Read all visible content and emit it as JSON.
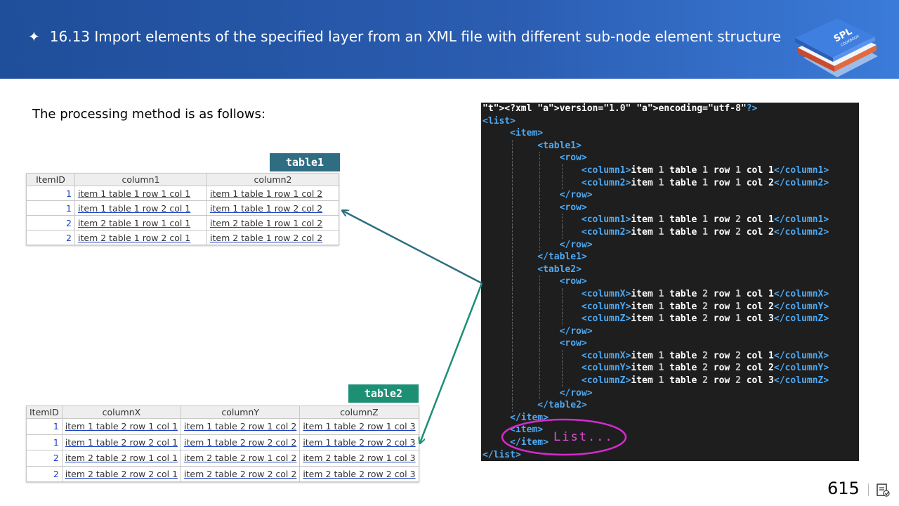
{
  "header": {
    "title": "16.13 Import elements of the specified layer from an XML file with different sub-node element structure",
    "star": "✦",
    "logo_text": "SPL",
    "logo_subtext": "COOKBOOK"
  },
  "intro": "The processing method is as follows:",
  "table1": {
    "tag": "table1",
    "columns": [
      "ItemID",
      "column1",
      "column2"
    ],
    "rows": [
      [
        "1",
        "item 1 table 1 row 1 col 1",
        "item 1 table 1 row 1 col 2"
      ],
      [
        "1",
        "item 1 table 1 row 2 col 1",
        "item 1 table 1 row 2 col 2"
      ],
      [
        "2",
        "item 2 table 1 row 1 col 1",
        "item 2 table 1 row 1 col 2"
      ],
      [
        "2",
        "item 2 table 1 row 2 col 1",
        "item 2 table 1 row 2 col 2"
      ]
    ]
  },
  "table2": {
    "tag": "table2",
    "columns": [
      "ItemID",
      "columnX",
      "columnY",
      "columnZ"
    ],
    "rows": [
      [
        "1",
        "item 1 table 2 row 1 col 1",
        "item 1 table 2 row 1 col 2",
        "item 1 table 2 row 1 col 3"
      ],
      [
        "1",
        "item 1 table 2 row 2 col 1",
        "item 1 table 2 row 2 col 2",
        "item 1 table 2 row 2 col 3"
      ],
      [
        "2",
        "item 2 table 2 row 1 col 1",
        "item 2 table 2 row 1 col 2",
        "item 2 table 2 row 1 col 3"
      ],
      [
        "2",
        "item 2 table 2 row 2 col 1",
        "item 2 table 2 row 2 col 2",
        "item 2 table 2 row 2 col 3"
      ]
    ]
  },
  "xml": {
    "lines": [
      "<?xml version=\"1.0\" encoding=\"utf-8\"?>",
      "<list>",
      "     <item>",
      "          <table1>",
      "              <row>",
      "                  <column1>item 1 table 1 row 1 col 1</column1>",
      "                  <column2>item 1 table 1 row 1 col 2</column2>",
      "              </row>",
      "              <row>",
      "                  <column1>item 1 table 1 row 2 col 1</column1>",
      "                  <column2>item 1 table 1 row 2 col 2</column2>",
      "              </row>",
      "          </table1>",
      "          <table2>",
      "              <row>",
      "                  <columnX>item 1 table 2 row 1 col 1</columnX>",
      "                  <columnY>item 1 table 2 row 1 col 2</columnY>",
      "                  <columnZ>item 1 table 2 row 1 col 3</columnZ>",
      "              </row>",
      "              <row>",
      "                  <columnX>item 1 table 2 row 2 col 1</columnX>",
      "                  <columnY>item 1 table 2 row 2 col 2</columnY>",
      "                  <columnZ>item 1 table 2 row 2 col 3</columnZ>",
      "              </row>",
      "          </table2>",
      "     </item>",
      "     <item>",
      "     </item>",
      "</list>"
    ],
    "annotation": "List..."
  },
  "colors": {
    "header_start": "#1f4e9a",
    "header_end": "#3b7bd9",
    "tag1": "#2f6e82",
    "tag2": "#1d8f74",
    "arrow1": "#2f6e82",
    "arrow2": "#1d8f74",
    "xml_bg": "#1e1e1e",
    "xml_tag": "#4fa8f0",
    "xml_attr": "#e05a4f",
    "annotation": "#e24bd6"
  },
  "footer": {
    "page_number": "615",
    "icon": "notes-icon"
  }
}
